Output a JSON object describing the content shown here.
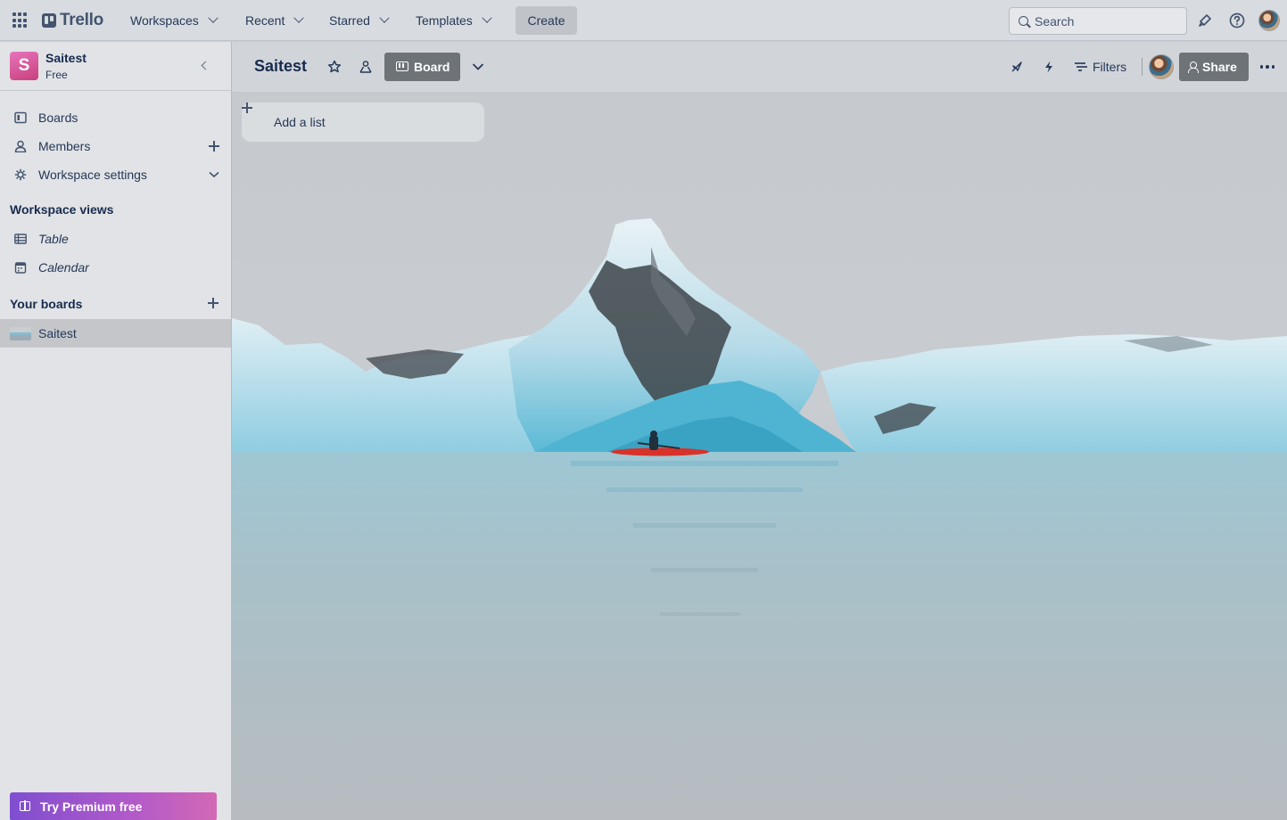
{
  "topnav": {
    "logo_text": "Trello",
    "menus": [
      "Workspaces",
      "Recent",
      "Starred",
      "Templates"
    ],
    "create_label": "Create",
    "search_placeholder": "Search"
  },
  "sidebar": {
    "workspace_name": "Saitest",
    "workspace_initial": "S",
    "workspace_plan": "Free",
    "items": [
      {
        "label": "Boards"
      },
      {
        "label": "Members"
      },
      {
        "label": "Workspace settings"
      }
    ],
    "views_title": "Workspace views",
    "views": [
      {
        "label": "Table"
      },
      {
        "label": "Calendar"
      }
    ],
    "boards_title": "Your boards",
    "boards": [
      {
        "label": "Saitest"
      }
    ],
    "premium_label": "Try Premium free"
  },
  "board": {
    "title": "Saitest",
    "view_label": "Board",
    "filters_label": "Filters",
    "share_label": "Share",
    "add_list_label": "Add a list"
  },
  "colors": {
    "workspace_badge": "#d9549c",
    "view_button": "#6e7378",
    "premium_gradient_start": "#7f4ed0",
    "premium_gradient_end": "#d268b5",
    "kayak": "#d8322b"
  }
}
